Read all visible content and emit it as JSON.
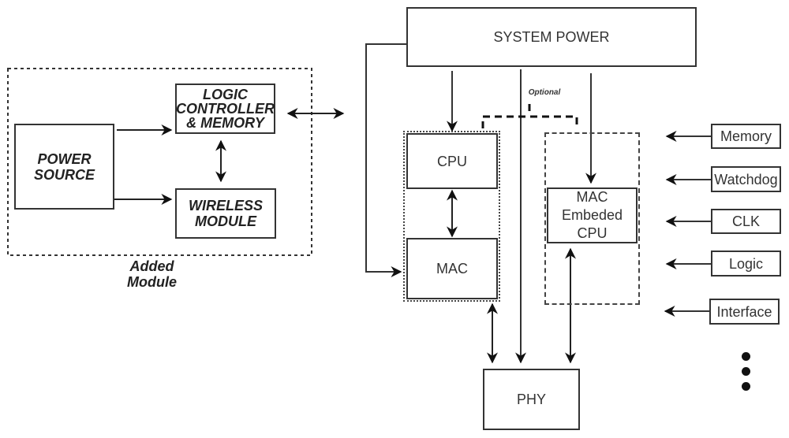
{
  "added_module": {
    "caption_line1": "Added",
    "caption_line2": "Module",
    "power_source": {
      "line1": "POWER",
      "line2": "SOURCE"
    },
    "logic_controller": {
      "line1": "LOGIC",
      "line2": "CONTROLLER",
      "line3": "& MEMORY"
    },
    "wireless_module": {
      "line1": "WIRELESS",
      "line2": "MODULE"
    }
  },
  "system": {
    "system_power": "SYSTEM POWER",
    "optional_label": "Optional",
    "cpu": "CPU",
    "mac": "MAC",
    "mac_embedded_cpu": {
      "line1": "MAC",
      "line2": "Embeded",
      "line3": "CPU"
    },
    "phy": "PHY"
  },
  "peripherals": [
    {
      "label": "Memory"
    },
    {
      "label": "Watchdog"
    },
    {
      "label": "CLK"
    },
    {
      "label": "Logic"
    },
    {
      "label": "Interface"
    }
  ],
  "continuation": "more-peripherals-ellipsis"
}
